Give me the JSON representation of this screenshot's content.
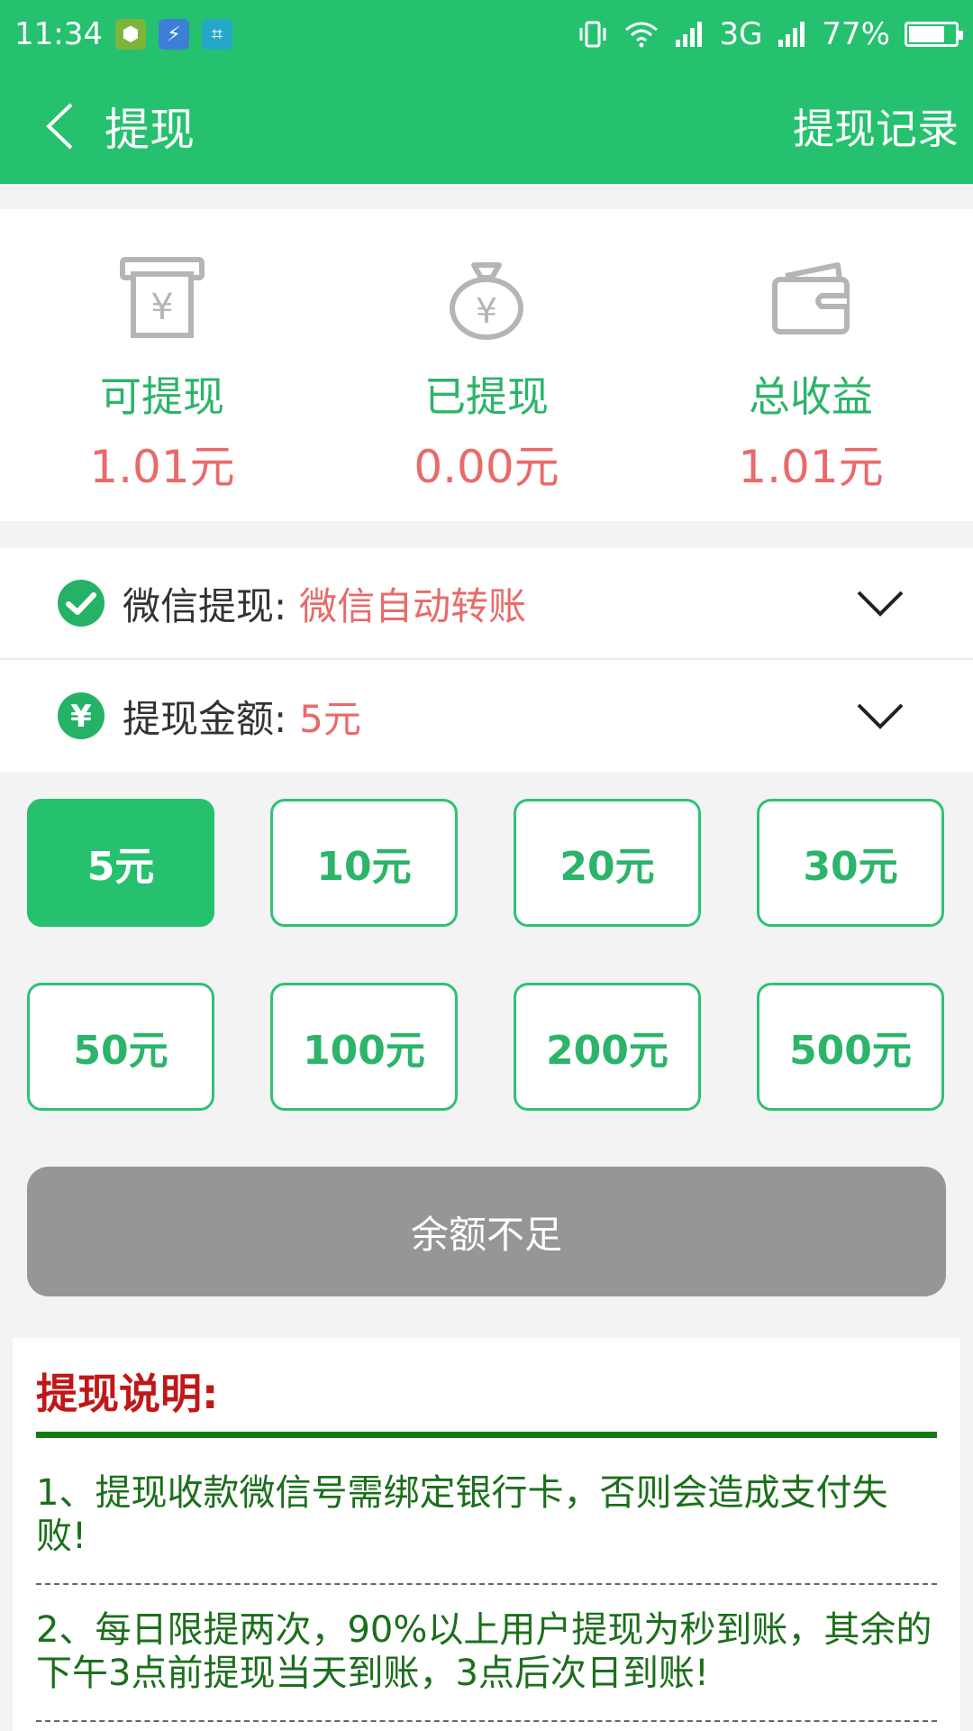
{
  "status_bar": {
    "time": "11:34",
    "network": "3G",
    "battery": "77%",
    "battery_level": 0.77
  },
  "app_bar": {
    "title": "提现",
    "action": "提现记录"
  },
  "stats": [
    {
      "label": "可提现",
      "value": "1.01元",
      "icon": "atm-yuan-icon"
    },
    {
      "label": "已提现",
      "value": "0.00元",
      "icon": "money-bag-icon"
    },
    {
      "label": "总收益",
      "value": "1.01元",
      "icon": "wallet-icon"
    }
  ],
  "method": {
    "label": "微信提现:",
    "value": "微信自动转账",
    "icon": "wechat-icon"
  },
  "amount_row": {
    "label": "提现金额:",
    "value": "5元",
    "icon": "yuan-icon"
  },
  "amounts": [
    "5元",
    "10元",
    "20元",
    "30元",
    "50元",
    "100元",
    "200元",
    "500元"
  ],
  "selected_amount": "5元",
  "submit_label": "余额不足",
  "notes": {
    "title": "提现说明:",
    "items": [
      "1、提现收款微信号需绑定银行卡，否则会造成支付失败!",
      "2、每日限提两次，90%以上用户提现为秒到账，其余的下午3点前提现当天到账，3点后次日到账!"
    ]
  },
  "colors": {
    "brand_green": "#25c16f",
    "value_red": "#e96a6a",
    "disabled_gray": "#969696",
    "notes_title_red": "#c01818",
    "notes_text_green": "#1b6f1b"
  }
}
